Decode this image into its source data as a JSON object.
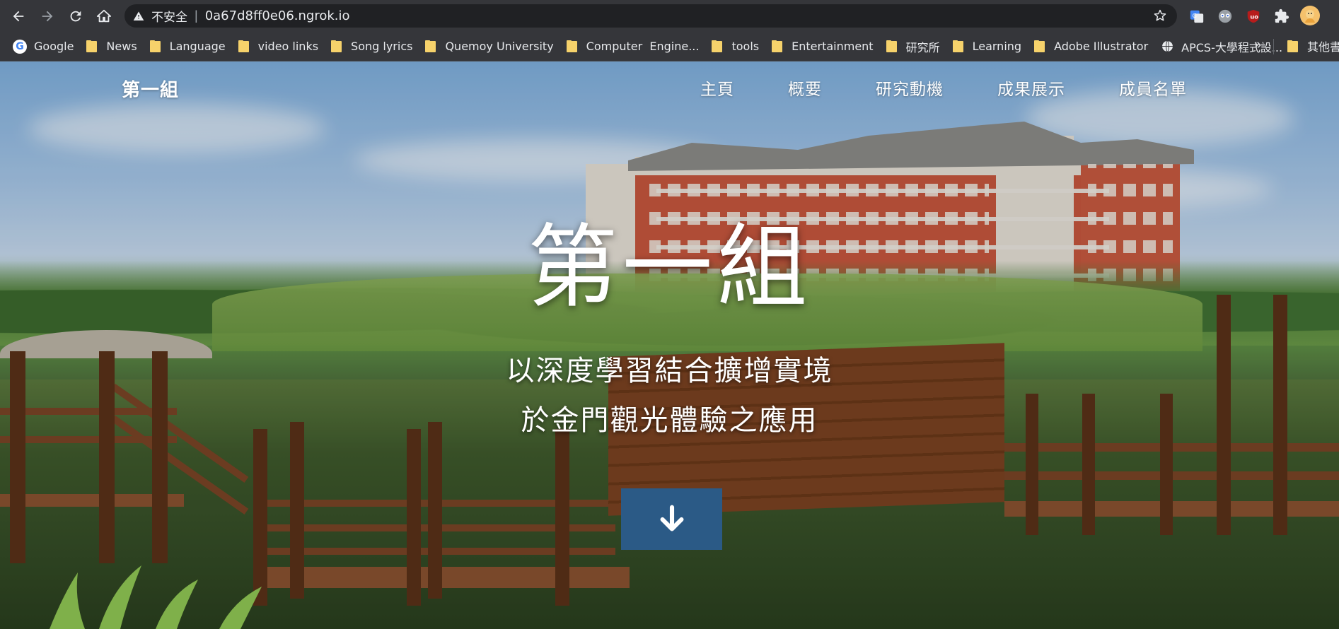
{
  "browser": {
    "security_label": "不安全",
    "url": "0a67d8ff0e06.ngrok.io",
    "bookmarks": [
      {
        "label": "Google",
        "icon": "google-icon"
      },
      {
        "label": "News",
        "icon": "folder-icon"
      },
      {
        "label": "Language",
        "icon": "folder-icon"
      },
      {
        "label": "video links",
        "icon": "folder-icon"
      },
      {
        "label": "Song lyrics",
        "icon": "folder-icon"
      },
      {
        "label": "Quemoy University",
        "icon": "folder-icon"
      },
      {
        "label": "Computer  Engine...",
        "icon": "folder-icon"
      },
      {
        "label": "tools",
        "icon": "folder-icon"
      },
      {
        "label": "Entertainment",
        "icon": "folder-icon"
      },
      {
        "label": "研究所",
        "icon": "folder-icon"
      },
      {
        "label": "Learning",
        "icon": "folder-icon"
      },
      {
        "label": "Adobe Illustrator",
        "icon": "folder-icon"
      },
      {
        "label": "APCS-大學程式設...",
        "icon": "globe-icon"
      }
    ],
    "overflow_label": "»",
    "other_bookmarks": "其他書籤"
  },
  "site": {
    "brand": "第一組",
    "nav": [
      "主頁",
      "概要",
      "研究動機",
      "成果展示",
      "成員名單"
    ],
    "hero_title": "第一組",
    "hero_line1": "以深度學習結合擴增實境",
    "hero_line2": "於金門觀光體驗之應用"
  },
  "colors": {
    "toolbar": "#35363a",
    "omnibox": "#202124",
    "scroll_button": "#2b5a86"
  }
}
